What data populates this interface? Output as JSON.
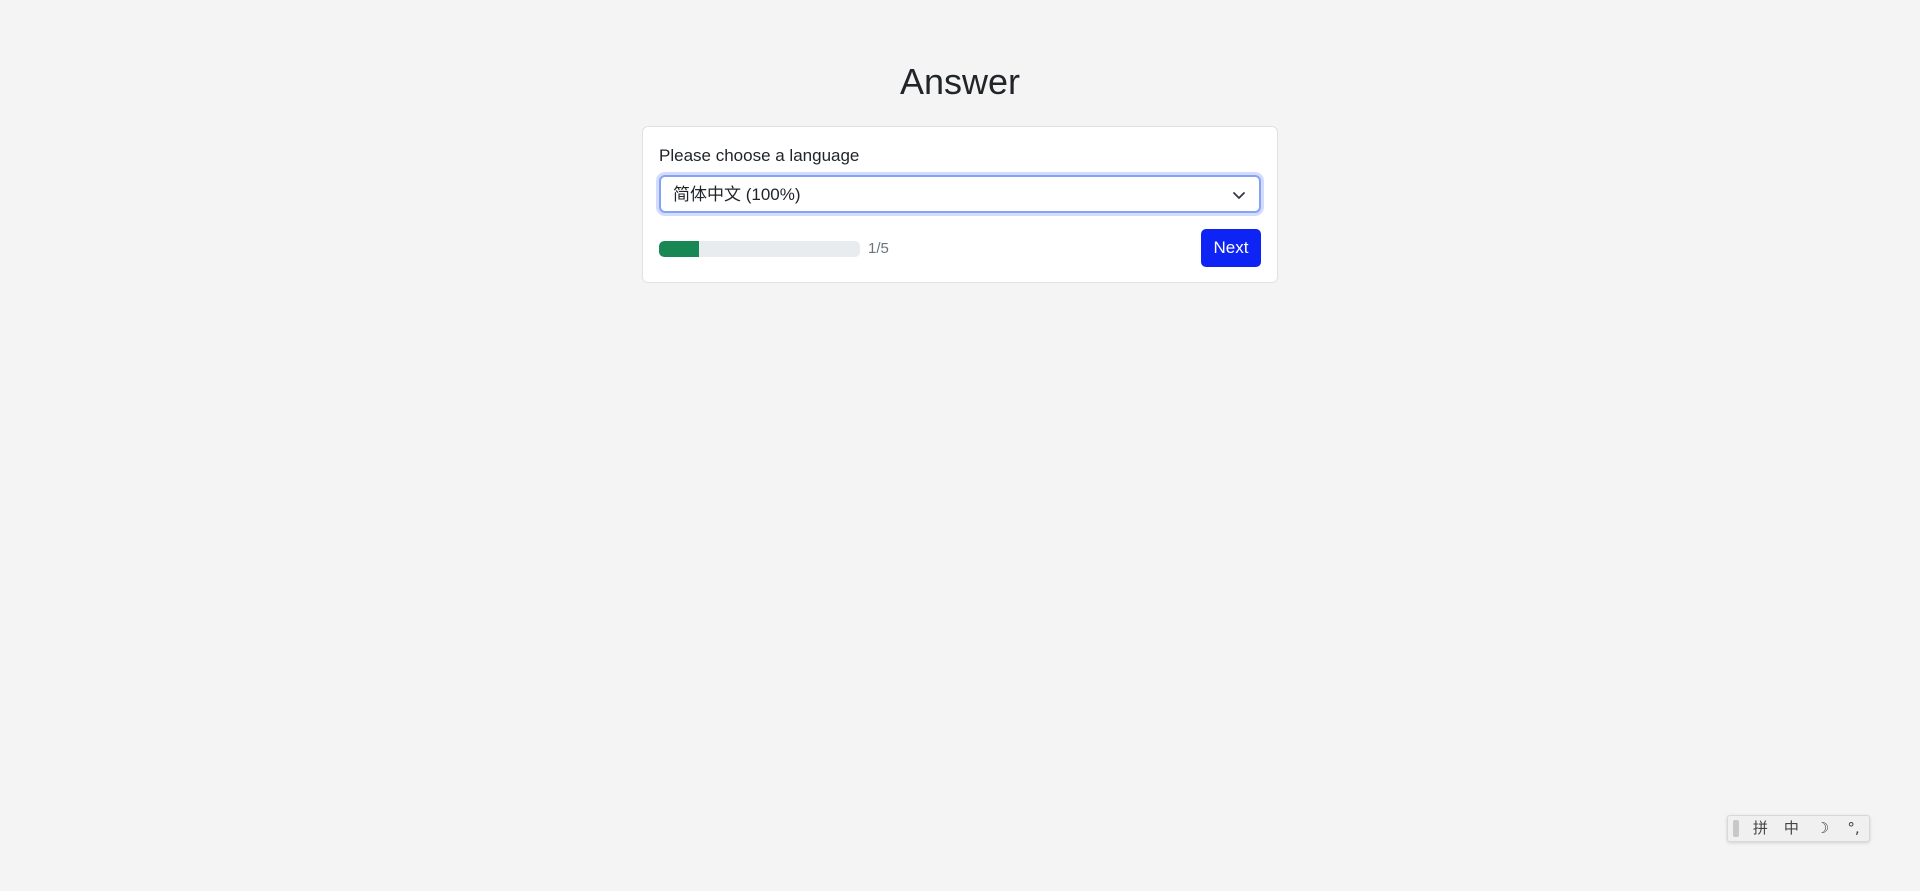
{
  "page": {
    "title": "Answer"
  },
  "language_form": {
    "label": "Please choose a language",
    "selected_value": "简体中文 (100%)"
  },
  "progress": {
    "current": 1,
    "total": 5,
    "count_text": "1/5",
    "fraction": 0.2
  },
  "actions": {
    "next_label": "Next"
  },
  "ime_toolbar": {
    "pinyin_label": "拼",
    "chinese_label": "中",
    "moon_label": "☽",
    "punct_label": "°,"
  },
  "colors": {
    "accent": "#0d24f5",
    "progress": "#198754",
    "background": "#f4f4f4"
  }
}
